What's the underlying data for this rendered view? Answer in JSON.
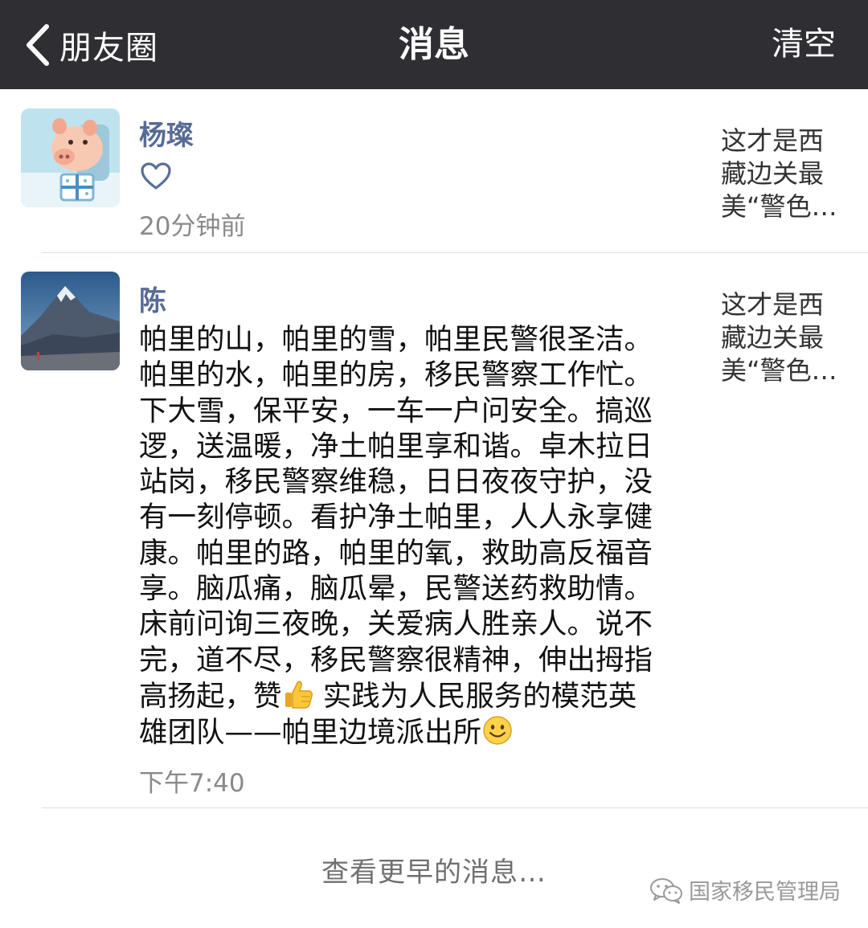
{
  "navbar": {
    "back_label": "朋友圈",
    "title": "消息",
    "clear_label": "清空"
  },
  "messages": [
    {
      "name": "杨璨",
      "action_icon": "heart-outline-icon",
      "time": "20分钟前",
      "preview": "这才是西\n藏边关最\n美“警色…"
    },
    {
      "name": "陈",
      "comment_text_1": "帕里的山，帕里的雪，帕里民警很圣洁。\n帕里的水，帕里的房，移民警察工作忙。\n下大雪，保平安，一车一户问安全。搞巡\n逻，送温暖，净土帕里享和谐。卓木拉日\n站岗，移民警察维稳，日日夜夜守护，没\n有一刻停顿。看护净土帕里，人人永享健\n康。帕里的路，帕里的氧，救助高反福音\n享。脑瓜痛，脑瓜晕，民警送药救助情。\n床前问询三夜晚，关爱病人胜亲人。说不\n完，道不尽，移民警察很精神，伸出拇指\n高扬起，赞",
      "emoji_1": "thumbs-up-icon",
      "comment_text_2": " 实践为人民服务的模范英\n雄团队——帕里边境派出所",
      "emoji_2": "smile-icon",
      "time": "下午7:40",
      "preview": "这才是西\n藏边关最\n美“警色…"
    }
  ],
  "load_more": "查看更早的消息…",
  "watermark": {
    "icon": "wechat-icon",
    "text": "国家移民管理局"
  }
}
